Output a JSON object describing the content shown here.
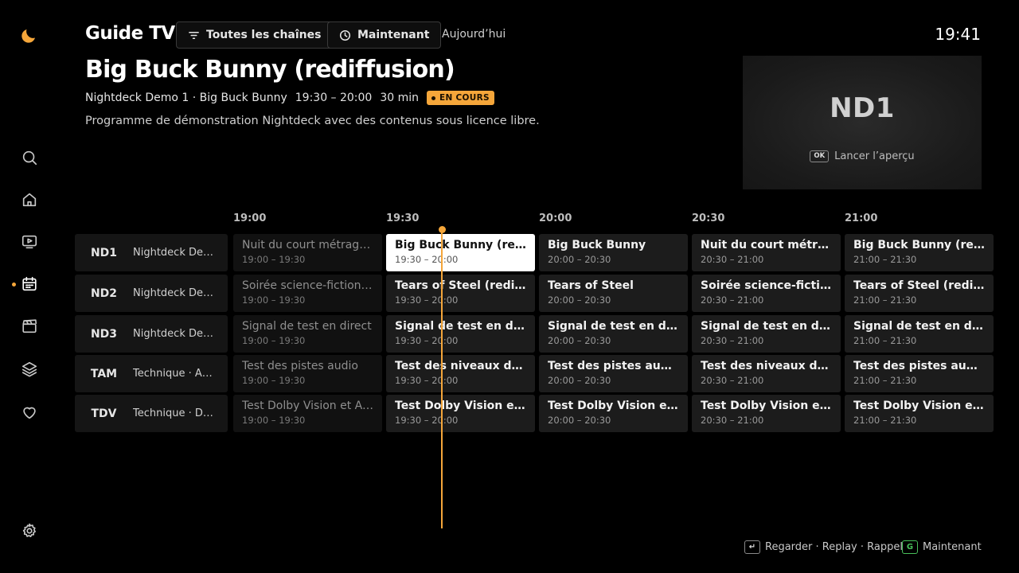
{
  "header": {
    "title": "Guide TV",
    "filter_label": "Toutes les chaînes",
    "now_label": "Maintenant",
    "day_label": "Aujourd’hui",
    "clock": "19:41"
  },
  "nav": {
    "items": [
      "search-icon",
      "home-icon",
      "tv-play-icon",
      "calendar-icon",
      "clapperboard-icon",
      "layers-icon",
      "heart-icon",
      "gear-icon"
    ],
    "active": "calendar-icon",
    "accent": "#f5a63a"
  },
  "program": {
    "title": "Big Buck Bunny (rediffusion)",
    "channel_line": "Nightdeck Demo 1 · Big Buck Bunny",
    "time_range": "19:30 – 20:00",
    "duration": "30 min",
    "badge": "EN COURS",
    "description": "Programme de démonstration Nightdeck avec des contenus sous licence libre."
  },
  "preview": {
    "logo": "ND1",
    "key": "OK",
    "hint": "Lancer l’aperçu"
  },
  "timeline": {
    "times": [
      "19:00",
      "19:30",
      "20:00",
      "20:30",
      "21:00"
    ]
  },
  "channels": [
    {
      "code": "ND1",
      "name": "Nightdeck De…",
      "programs": [
        {
          "title": "Nuit du court métrage : …",
          "time": "19:00 – 19:30"
        },
        {
          "title": "Big Buck Bunny (rediffu…",
          "time": "19:30 – 20:00"
        },
        {
          "title": "Big Buck Bunny",
          "time": "20:00 – 20:30"
        },
        {
          "title": "Nuit du court métrage : …",
          "time": "20:30 – 21:00"
        },
        {
          "title": "Big Buck Bunny (rediffu…",
          "time": "21:00 – 21:30"
        }
      ]
    },
    {
      "code": "ND2",
      "name": "Nightdeck De…",
      "programs": [
        {
          "title": "Soirée science-fiction …",
          "time": "19:00 – 19:30"
        },
        {
          "title": "Tears of Steel (rediffusi…",
          "time": "19:30 – 20:00"
        },
        {
          "title": "Tears of Steel",
          "time": "20:00 – 20:30"
        },
        {
          "title": "Soirée science-fiction …",
          "time": "20:30 – 21:00"
        },
        {
          "title": "Tears of Steel (rediffusi…",
          "time": "21:00 – 21:30"
        }
      ]
    },
    {
      "code": "ND3",
      "name": "Nightdeck De…",
      "programs": [
        {
          "title": "Signal de test en direct",
          "time": "19:00 – 19:30"
        },
        {
          "title": "Signal de test en direct",
          "time": "19:30 – 20:00"
        },
        {
          "title": "Signal de test en direct",
          "time": "20:00 – 20:30"
        },
        {
          "title": "Signal de test en direct",
          "time": "20:30 – 21:00"
        },
        {
          "title": "Signal de test en direct",
          "time": "21:00 – 21:30"
        }
      ]
    },
    {
      "code": "TAM",
      "name": "Technique · Au…",
      "programs": [
        {
          "title": "Test des pistes audio",
          "time": "19:00 – 19:30"
        },
        {
          "title": "Test des niveaux de qu…",
          "time": "19:30 – 20:00"
        },
        {
          "title": "Test des pistes audio",
          "time": "20:00 – 20:30"
        },
        {
          "title": "Test des niveaux de qu…",
          "time": "20:30 – 21:00"
        },
        {
          "title": "Test des pistes audio",
          "time": "21:00 – 21:30"
        }
      ]
    },
    {
      "code": "TDV",
      "name": "Technique · Dol…",
      "programs": [
        {
          "title": "Test Dolby Vision et At…",
          "time": "19:00 – 19:30"
        },
        {
          "title": "Test Dolby Vision et At…",
          "time": "19:30 – 20:00"
        },
        {
          "title": "Test Dolby Vision et At…",
          "time": "20:00 – 20:30"
        },
        {
          "title": "Test Dolby Vision et At…",
          "time": "20:30 – 21:00"
        },
        {
          "title": "Test Dolby Vision et At…",
          "time": "21:00 – 21:30"
        }
      ]
    }
  ],
  "footer": {
    "enter_key": "↵",
    "actions": "Regarder · Replay · Rappel",
    "now_key": "G",
    "now_label": "Maintenant"
  }
}
